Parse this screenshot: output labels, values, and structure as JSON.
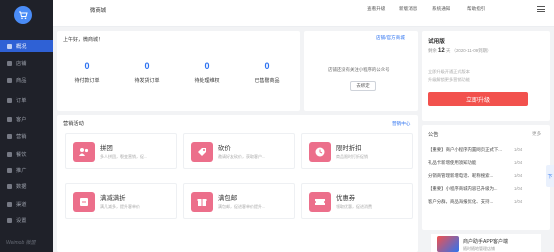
{
  "sidebar": {
    "items": [
      {
        "label": "概况",
        "active": true
      },
      {
        "label": "店铺"
      },
      {
        "label": "商品"
      },
      {
        "label": "订单"
      },
      {
        "label": "客户"
      },
      {
        "label": "营销"
      },
      {
        "label": "餐饮"
      },
      {
        "label": "推广"
      },
      {
        "label": "数据"
      },
      {
        "label": "渠道"
      },
      {
        "label": "设置"
      }
    ],
    "brand": "Weimob 微盟"
  },
  "topbar": {
    "shop_name": "微商城",
    "links": [
      "查看升级",
      "新版消息",
      "系统通知",
      "帮助指引"
    ]
  },
  "overview": {
    "greeting": "上午好，微商城！",
    "stats": [
      {
        "value": "0",
        "label": "待付款订单"
      },
      {
        "value": "0",
        "label": "待发货订单"
      },
      {
        "value": "0",
        "label": "待处理维权"
      },
      {
        "value": "0",
        "label": "已售罄商品"
      }
    ]
  },
  "shop_card": {
    "link": "店铺/官方商城",
    "info": "店铺还没有关注小程序的公众号",
    "button": "去绑定"
  },
  "marketing": {
    "title": "营销活动",
    "link": "营销中心",
    "items": [
      {
        "name": "拼团",
        "desc": "多人拼团，裂变营销，促..."
      },
      {
        "name": "砍价",
        "desc": "邀请好友砍价，获取客户..."
      },
      {
        "name": "限时折扣",
        "desc": "商品限时打折促销"
      },
      {
        "name": "满减满折",
        "desc": "满几减多，提升客单价"
      },
      {
        "name": "满包邮",
        "desc": "满包邮，促进客单价提升..."
      },
      {
        "name": "优惠券",
        "desc": "领取优惠，促进消费"
      }
    ]
  },
  "version": {
    "title": "试用版",
    "days_prefix": "剩余",
    "days": "12",
    "days_unit": "天",
    "expiry": "（2020-11-09到期）",
    "notes": [
      "立即升级开通正式版本",
      "升级解锁更多营销功能"
    ],
    "upgrade_button": "立即升级"
  },
  "announcements": {
    "title": "公告",
    "more": "更多",
    "rows": [
      {
        "text": "【重要】商户小程序内置网页正式下...",
        "date": "1/04"
      },
      {
        "text": "礼品卡新增使用须知功能",
        "date": "1/04"
      },
      {
        "text": "分销商管理新增电话、昵称搜索...",
        "date": "1/04"
      },
      {
        "text": "【重要】小程序商城内容已升级为...",
        "date": "1/04"
      },
      {
        "text": "客户分群，商品海报优化、支持...",
        "date": "1/04"
      }
    ]
  },
  "ad": {
    "title": "商户助手APP客户端",
    "subtitle": "随时随地管理店铺"
  },
  "float_tab": "下"
}
